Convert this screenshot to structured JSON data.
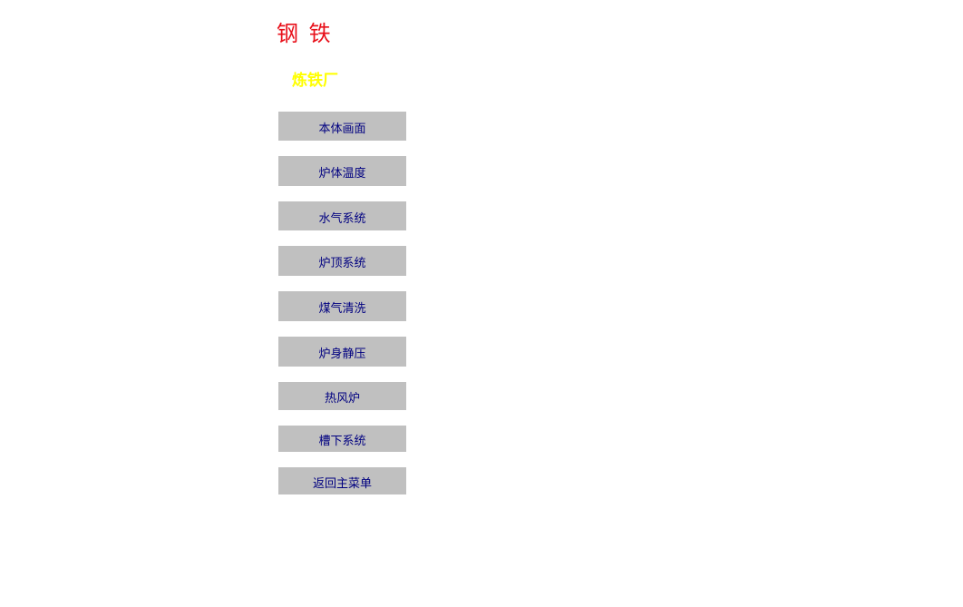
{
  "header": {
    "title": "钢 铁",
    "subtitle": "炼铁厂"
  },
  "menu": {
    "items": [
      {
        "label": "本体画面"
      },
      {
        "label": "炉体温度"
      },
      {
        "label": "水气系统"
      },
      {
        "label": "炉顶系统"
      },
      {
        "label": "煤气清洗"
      },
      {
        "label": "炉身静压"
      },
      {
        "label": "热风炉"
      },
      {
        "label": "槽下系统"
      },
      {
        "label": "返回主菜单"
      }
    ]
  },
  "colors": {
    "title": "#e8101a",
    "subtitle": "#ffff00",
    "button_bg": "#c0c0c0",
    "button_text": "#000080"
  }
}
